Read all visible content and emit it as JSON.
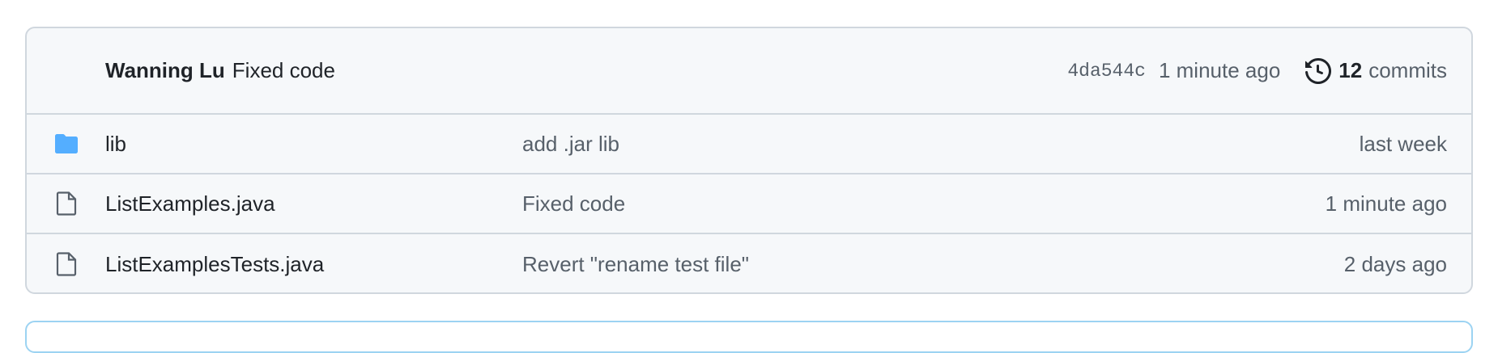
{
  "commit": {
    "author": "Wanning Lu",
    "message": "Fixed code",
    "sha": "4da544c",
    "time": "1 minute ago",
    "count": "12",
    "count_label": "commits"
  },
  "files": [
    {
      "icon": "folder-icon",
      "name": "lib",
      "message": "add .jar lib",
      "age": "last week"
    },
    {
      "icon": "file-icon",
      "name": "ListExamples.java",
      "message": "Fixed code",
      "age": "1 minute ago"
    },
    {
      "icon": "file-icon",
      "name": "ListExamplesTests.java",
      "message": "Revert \"rename test file\"",
      "age": "2 days ago"
    }
  ],
  "colors": {
    "folder": "#54aeff",
    "border": "#d0d7de",
    "muted": "#57606a"
  }
}
